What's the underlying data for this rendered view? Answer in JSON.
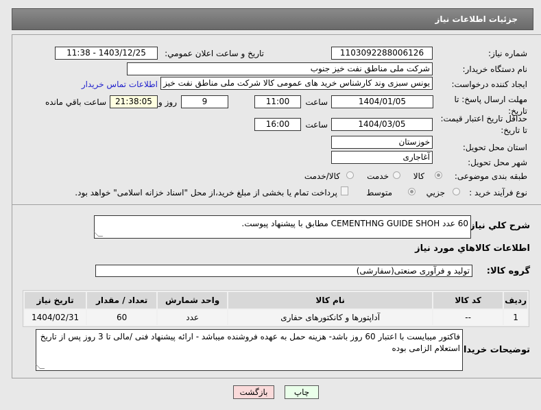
{
  "header": {
    "title": "جزئیات اطلاعات نیاز"
  },
  "form": {
    "need_number_label": "شماره نیاز:",
    "need_number": "1103092288006126",
    "announce_label": "تاریخ و ساعت اعلان عمومي:",
    "announce_value": "1403/12/25 - 11:38",
    "buyer_label": "نام دستگاه خریدار:",
    "buyer": "شرکت ملی مناطق نفت خیز جنوب",
    "creator_label": "ایجاد کننده درخواست:",
    "creator": "یونس سبزی وند کارشناس خرید های عمومی کالا شرکت ملی مناطق نفت خیز",
    "contact_link": "اطلاعات تماس خریدار",
    "deadline_label": "مهلت ارسال پاسخ: تا تاریخ:",
    "deadline_date": "1404/01/05",
    "time_label": "ساعت",
    "deadline_time": "11:00",
    "days": "9",
    "days_label": "روز و",
    "remaining": "21:38:05",
    "remaining_label": "ساعت باقي مانده",
    "validity_label": "حداقل تاریخ اعتبار قیمت: تا تاریخ:",
    "validity_date": "1404/03/05",
    "validity_time": "16:00",
    "province_label": "استان محل تحویل:",
    "province": "خوزستان",
    "city_label": "شهر محل تحویل:",
    "city": "آغاجاری",
    "category_label": "طبقه بندی موضوعی:",
    "category_options": [
      "کالا",
      "خدمت",
      "کالا/خدمت"
    ],
    "process_label": "نوع فرآیند خرید :",
    "process_options": [
      "جزیي",
      "متوسط"
    ],
    "payment_note": "پرداخت تمام یا بخشی از مبلغ خرید،از محل \"اسناد خزانه اسلامی\" خواهد بود."
  },
  "summary": {
    "label": "شرح کلي نياز:",
    "text": "60 عدد CEMENTHNG GUIDE SHOH مطابق با پیشنهاد پیوست."
  },
  "goods": {
    "title": "اطلاعات کالاهاي مورد نياز",
    "group_label": "گروه کالا:",
    "group": "تولید و فرآوری صنعتی(سفارشی)",
    "columns": [
      "ردیف",
      "کد کالا",
      "نام کالا",
      "واحد شمارش",
      "تعداد / مقدار",
      "تاریخ نیاز"
    ],
    "rows": [
      [
        "1",
        "--",
        "آداپتورها و کانکتورهای حفاری",
        "عدد",
        "60",
        "1404/02/31"
      ]
    ]
  },
  "notes": {
    "label": "توضیحات خریدار:",
    "text": "فاکتور میبایست با اعتبار 60 روز باشد- هزینه حمل به عهده فروشنده میباشد - ارائه پیشنهاد فنی /مالی تا 3 روز پس از تاریخ استعلام الزامی بوده"
  },
  "buttons": {
    "back": "بازگشت",
    "print": "چاپ"
  },
  "colors": {
    "link": "#2222cc",
    "back_bg": "#fadada",
    "print_bg": "#eaffea"
  }
}
